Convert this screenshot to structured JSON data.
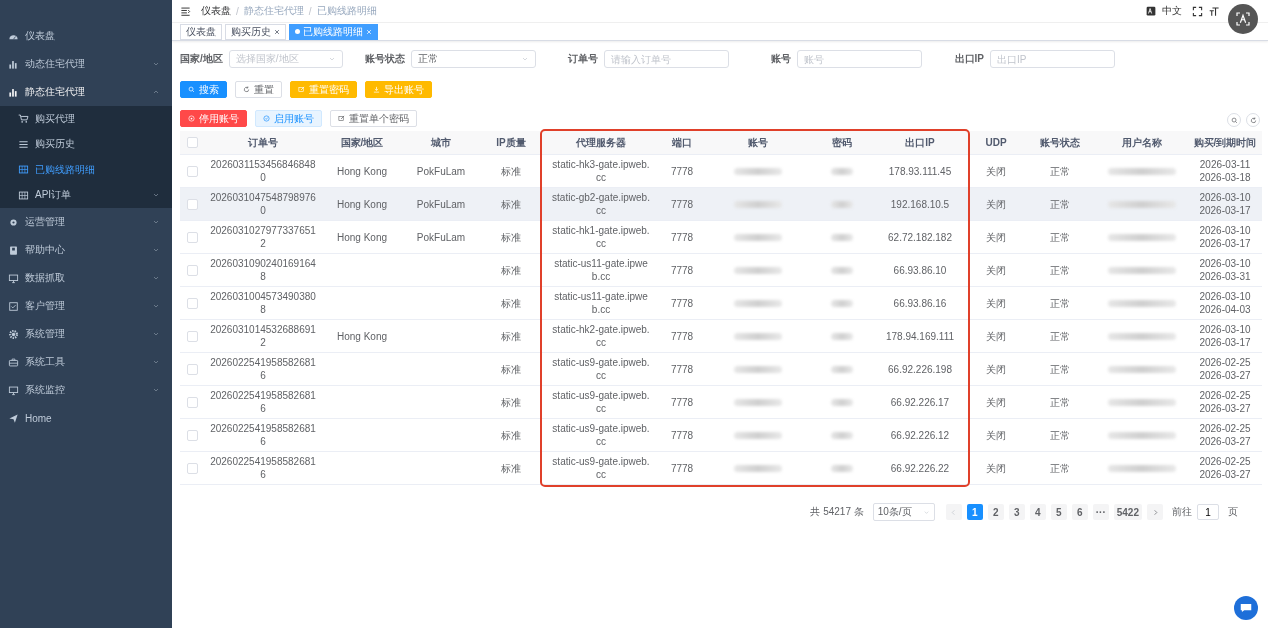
{
  "sidebar": {
    "items": [
      {
        "label": "仪表盘",
        "kind": "link",
        "selected": false
      },
      {
        "label": "动态住宅代理",
        "kind": "group",
        "expanded": false,
        "selected": false
      },
      {
        "label": "静态住宅代理",
        "kind": "group",
        "expanded": true,
        "selected": false,
        "children": [
          {
            "label": "购买代理",
            "kind": "link",
            "selected": false
          },
          {
            "label": "购买历史",
            "kind": "link",
            "selected": false
          },
          {
            "label": "已购线路明细",
            "kind": "link",
            "selected": true
          },
          {
            "label": "API订单",
            "kind": "group",
            "expanded": false,
            "selected": false
          }
        ]
      },
      {
        "label": "运营管理",
        "kind": "group",
        "expanded": false,
        "selected": false
      },
      {
        "label": "帮助中心",
        "kind": "group",
        "expanded": false,
        "selected": false
      },
      {
        "label": "数据抓取",
        "kind": "group",
        "expanded": false,
        "selected": false
      },
      {
        "label": "客户管理",
        "kind": "group",
        "expanded": false,
        "selected": false
      },
      {
        "label": "系统管理",
        "kind": "group",
        "expanded": false,
        "selected": false
      },
      {
        "label": "系统工具",
        "kind": "group",
        "expanded": false,
        "selected": false
      },
      {
        "label": "系统监控",
        "kind": "group",
        "expanded": false,
        "selected": false
      },
      {
        "label": "Home",
        "kind": "link",
        "selected": false
      }
    ]
  },
  "header": {
    "breadcrumbs": [
      "仪表盘",
      "静态住宅代理",
      "已购线路明细"
    ],
    "separator": "/",
    "language": "中文"
  },
  "tags": [
    {
      "label": "仪表盘",
      "closable": false,
      "selected": false
    },
    {
      "label": "购买历史",
      "closable": true,
      "selected": false
    },
    {
      "label": "已购线路明细",
      "closable": true,
      "selected": true
    }
  ],
  "filters": [
    {
      "label": "国家/地区",
      "kind": "select",
      "placeholder": "选择国家/地区"
    },
    {
      "label": "账号状态",
      "kind": "select",
      "value": "正常"
    },
    {
      "label": "订单号",
      "kind": "input",
      "placeholder": "请输入订单号"
    },
    {
      "label": "账号",
      "kind": "input",
      "placeholder": "账号"
    },
    {
      "label": "出口IP",
      "kind": "input",
      "placeholder": "出口IP"
    }
  ],
  "actions": [
    {
      "label": "搜索",
      "kind": "primary"
    },
    {
      "label": "重置",
      "kind": "plain"
    },
    {
      "label": "重置密码",
      "kind": "warning"
    },
    {
      "label": "导出账号",
      "kind": "warning"
    }
  ],
  "row_actions": [
    {
      "label": "停用账号",
      "kind": "danger"
    },
    {
      "label": "启用账号",
      "kind": "info"
    },
    {
      "label": "重置单个密码",
      "kind": "plain"
    }
  ],
  "table": {
    "all_checked": false,
    "columns": [
      {
        "label": "订单号",
        "kind": "text",
        "highlighted": false
      },
      {
        "label": "国家/地区",
        "kind": "text",
        "highlighted": false
      },
      {
        "label": "城市",
        "kind": "text",
        "highlighted": false
      },
      {
        "label": "IP质量",
        "kind": "text",
        "highlighted": false
      },
      {
        "label": "代理服务器",
        "kind": "text",
        "highlighted": true
      },
      {
        "label": "端口",
        "kind": "text",
        "highlighted": true
      },
      {
        "label": "账号",
        "kind": "blurred",
        "highlighted": true
      },
      {
        "label": "密码",
        "kind": "blurred",
        "highlighted": true
      },
      {
        "label": "出口IP",
        "kind": "text",
        "highlighted": true
      },
      {
        "label": "UDP",
        "kind": "text",
        "highlighted": false
      },
      {
        "label": "账号状态",
        "kind": "text",
        "highlighted": false
      },
      {
        "label": "用户名称",
        "kind": "blurred",
        "highlighted": false
      },
      {
        "label": "购买/到期时间",
        "kind": "dates",
        "highlighted": false
      }
    ],
    "rows": [
      {
        "checked": false,
        "hovered": false,
        "cells": [
          "20260311534568468480",
          "Hong Kong",
          "PokFuLam",
          "标准",
          "static-hk3-gate.ipweb.cc",
          "7778",
          null,
          null,
          "178.93.111.45",
          "关闭",
          "正常",
          null,
          [
            "2026-03-11",
            "2026-03-18"
          ]
        ]
      },
      {
        "checked": false,
        "hovered": true,
        "cells": [
          "20260310475487989760",
          "Hong Kong",
          "PokFuLam",
          "标准",
          "static-gb2-gate.ipweb.cc",
          "7778",
          null,
          null,
          "192.168.10.5",
          "关闭",
          "正常",
          null,
          [
            "2026-03-10",
            "2026-03-17"
          ]
        ]
      },
      {
        "checked": false,
        "hovered": false,
        "cells": [
          "20260310279773376512",
          "Hong Kong",
          "PokFuLam",
          "标准",
          "static-hk1-gate.ipweb.cc",
          "7778",
          null,
          null,
          "62.72.182.182",
          "关闭",
          "正常",
          null,
          [
            "2026-03-10",
            "2026-03-17"
          ]
        ]
      },
      {
        "checked": false,
        "hovered": false,
        "cells": [
          "20260310902401691648",
          null,
          null,
          "标准",
          "static-us11-gate.ipweb.cc",
          "7778",
          null,
          null,
          "66.93.86.10",
          "关闭",
          "正常",
          null,
          [
            "2026-03-10",
            "2026-03-31"
          ]
        ]
      },
      {
        "checked": false,
        "hovered": false,
        "cells": [
          "20260310045734903808",
          null,
          null,
          "标准",
          "static-us11-gate.ipweb.cc",
          "7778",
          null,
          null,
          "66.93.86.16",
          "关闭",
          "正常",
          null,
          [
            "2026-03-10",
            "2026-04-03"
          ]
        ]
      },
      {
        "checked": false,
        "hovered": false,
        "cells": [
          "20260310145326886912",
          "Hong Kong",
          null,
          "标准",
          "static-hk2-gate.ipweb.cc",
          "7778",
          null,
          null,
          "178.94.169.111",
          "关闭",
          "正常",
          null,
          [
            "2026-03-10",
            "2026-03-17"
          ]
        ]
      },
      {
        "checked": false,
        "hovered": false,
        "cells": [
          "20260225419585826816",
          null,
          null,
          "标准",
          "static-us9-gate.ipweb.cc",
          "7778",
          null,
          null,
          "66.92.226.198",
          "关闭",
          "正常",
          null,
          [
            "2026-02-25",
            "2026-03-27"
          ]
        ]
      },
      {
        "checked": false,
        "hovered": false,
        "cells": [
          "20260225419585826816",
          null,
          null,
          "标准",
          "static-us9-gate.ipweb.cc",
          "7778",
          null,
          null,
          "66.92.226.17",
          "关闭",
          "正常",
          null,
          [
            "2026-02-25",
            "2026-03-27"
          ]
        ]
      },
      {
        "checked": false,
        "hovered": false,
        "cells": [
          "20260225419585826816",
          null,
          null,
          "标准",
          "static-us9-gate.ipweb.cc",
          "7778",
          null,
          null,
          "66.92.226.12",
          "关闭",
          "正常",
          null,
          [
            "2026-02-25",
            "2026-03-27"
          ]
        ]
      },
      {
        "checked": false,
        "hovered": false,
        "cells": [
          "20260225419585826816",
          null,
          null,
          "标准",
          "static-us9-gate.ipweb.cc",
          "7778",
          null,
          null,
          "66.92.226.22",
          "关闭",
          "正常",
          null,
          [
            "2026-02-25",
            "2026-03-27"
          ]
        ]
      }
    ]
  },
  "pagination": {
    "total": "共 54217 条",
    "page_size": "10条/页",
    "prev_disabled": true,
    "pages": [
      {
        "label": "1",
        "selected": true
      },
      {
        "label": "2",
        "selected": false
      },
      {
        "label": "3",
        "selected": false
      },
      {
        "label": "4",
        "selected": false
      },
      {
        "label": "5",
        "selected": false
      },
      {
        "label": "6",
        "selected": false
      },
      {
        "label": "···",
        "selected": false
      },
      {
        "label": "5422",
        "selected": false
      }
    ],
    "goto_prefix": "前往",
    "goto_value": "1",
    "goto_suffix": "页"
  }
}
